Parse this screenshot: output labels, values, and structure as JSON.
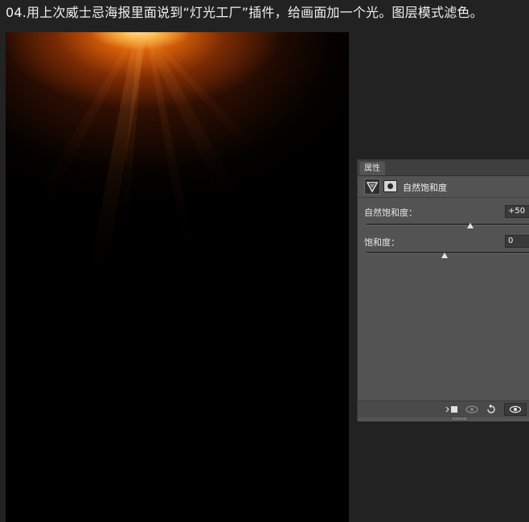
{
  "caption": "04.用上次威士忌海报里面说到“灯光工厂”插件，给画面加一个光。图层模式滤色。",
  "panel": {
    "tab_label": "属性",
    "header_title": "自然饱和度",
    "header_icons": [
      "vibrance-adjustment-icon",
      "layer-mask-icon"
    ],
    "fields": [
      {
        "label": "自然饱和度：",
        "value": "+50",
        "level": 50,
        "min": -100,
        "max": 100
      },
      {
        "label": "饱和度：",
        "value": "0",
        "level": 0,
        "min": -100,
        "max": 100
      }
    ],
    "footer_icons": [
      "clip-to-layer-icon",
      "view-previous-state-icon",
      "reset-icon",
      "visibility-eye-icon"
    ]
  },
  "colors": {
    "background": "#222222",
    "canvas": "#000000",
    "glow_core": "#ffdc8a",
    "glow_orange": "#f07a12",
    "panel": "#535353",
    "panel_tab": "#3f3f3f",
    "input": "#3a3a3a"
  }
}
